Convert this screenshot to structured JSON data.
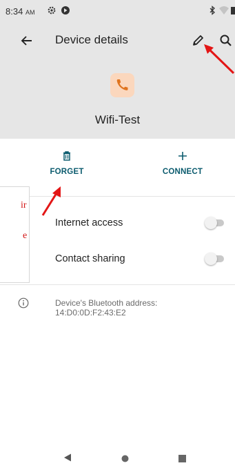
{
  "status_bar": {
    "time": "8:34",
    "ampm": "AM",
    "icons": [
      "gear-icon",
      "data-saver-icon",
      "bluetooth-icon",
      "wifi-icon",
      "battery-icon"
    ]
  },
  "toolbar": {
    "title": "Device details",
    "back_icon": "arrow-left-icon",
    "edit_icon": "pencil-icon",
    "search_icon": "search-icon"
  },
  "device": {
    "icon": "phone-icon",
    "name": "Wifi-Test"
  },
  "actions": [
    {
      "label": "FORGET",
      "icon": "trash-icon"
    },
    {
      "label": "CONNECT",
      "icon": "plus-icon"
    }
  ],
  "overlay": {
    "line1": "ir",
    "line2": "e"
  },
  "preferences": [
    {
      "label": "Internet access",
      "enabled": false
    },
    {
      "label": "Contact sharing",
      "enabled": false
    }
  ],
  "info": {
    "icon": "info-icon",
    "line1": "Device's Bluetooth address:",
    "line2": "14:D0:0D:F2:43:E2"
  },
  "nav_bar": {
    "back": "back-triangle-icon",
    "home": "home-circle-icon",
    "recents": "recents-square-icon"
  },
  "colors": {
    "header_bg": "#e6e6e6",
    "accent": "#0b5b6e",
    "annotation": "#d21414",
    "device_icon_bg": "#fbd7bd",
    "device_icon": "#e0741f"
  }
}
